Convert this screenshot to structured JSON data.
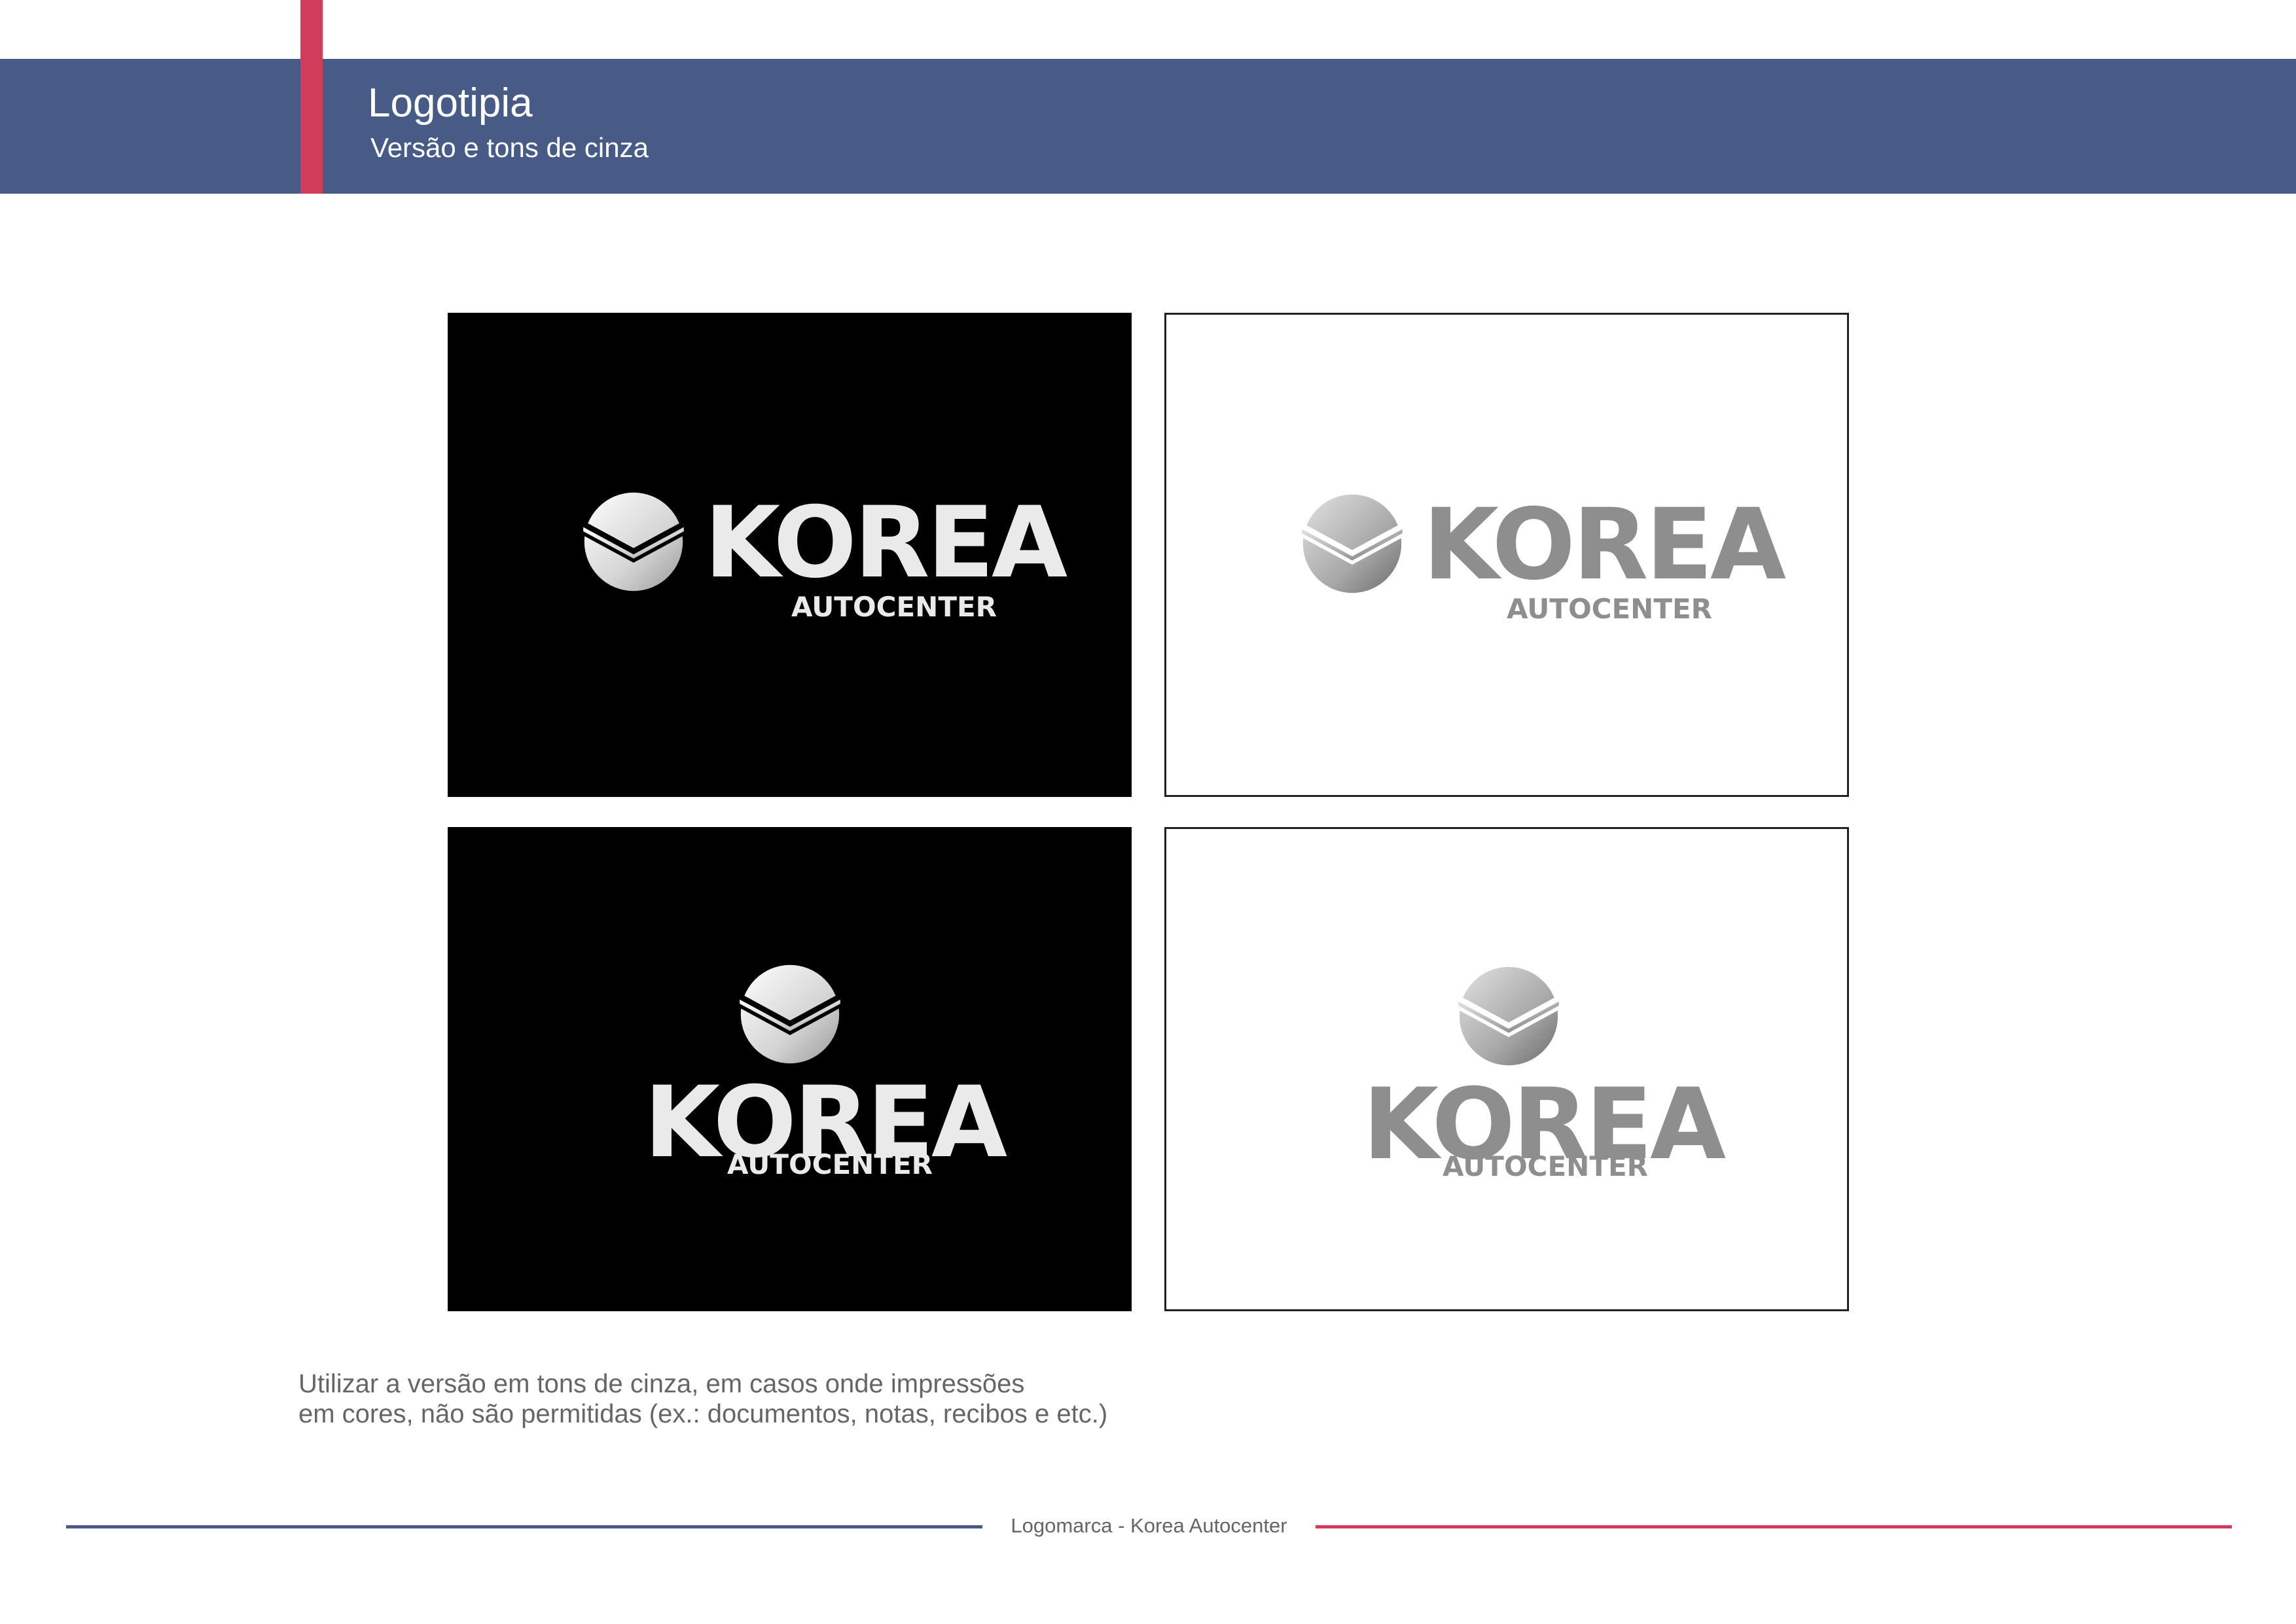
{
  "header": {
    "title": "Logotipia",
    "subtitle": "Versão e tons de cinza"
  },
  "logo": {
    "wordmark": "KOREA",
    "tagline": "AUTOCENTER",
    "emblem_icon": "korea-emblem-icon"
  },
  "note": {
    "line1": "Utilizar a versão em tons de cinza, em casos onde impressões",
    "line2": "em cores, não são permitidas (ex.: documentos, notas, recibos e etc.)"
  },
  "footer": {
    "text": "Logomarca - Korea Autocenter"
  },
  "colors": {
    "header_bar": "#485a86",
    "accent": "#d13c5a",
    "logo_on_dark": "#eaeaea",
    "logo_on_light": "#8e8e8e"
  }
}
